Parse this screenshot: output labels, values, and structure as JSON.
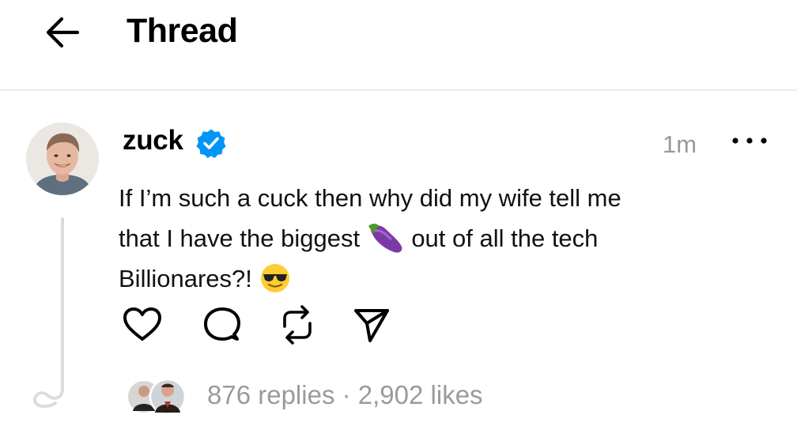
{
  "header": {
    "title": "Thread",
    "back_icon": "arrow-left-icon"
  },
  "post": {
    "username": "zuck",
    "verified": true,
    "verified_color": "#0095f6",
    "timestamp": "1m",
    "more_icon": "more-horizontal-icon",
    "text_line1": "If I’m such a cuck then why did my wife tell me",
    "text_line2a": "that I have the biggest",
    "text_line2b": "out of all the tech",
    "text_line3": "Billionares?!",
    "emoji_1": "eggplant-emoji",
    "emoji_2": "smiling-face-with-sunglasses-emoji"
  },
  "actions": [
    {
      "name": "like",
      "icon": "heart-icon"
    },
    {
      "name": "reply",
      "icon": "comment-icon"
    },
    {
      "name": "repost",
      "icon": "repost-icon"
    },
    {
      "name": "share",
      "icon": "send-icon"
    }
  ],
  "stats": {
    "replies": "876 replies",
    "separator": " · ",
    "likes": "2,902 likes"
  }
}
